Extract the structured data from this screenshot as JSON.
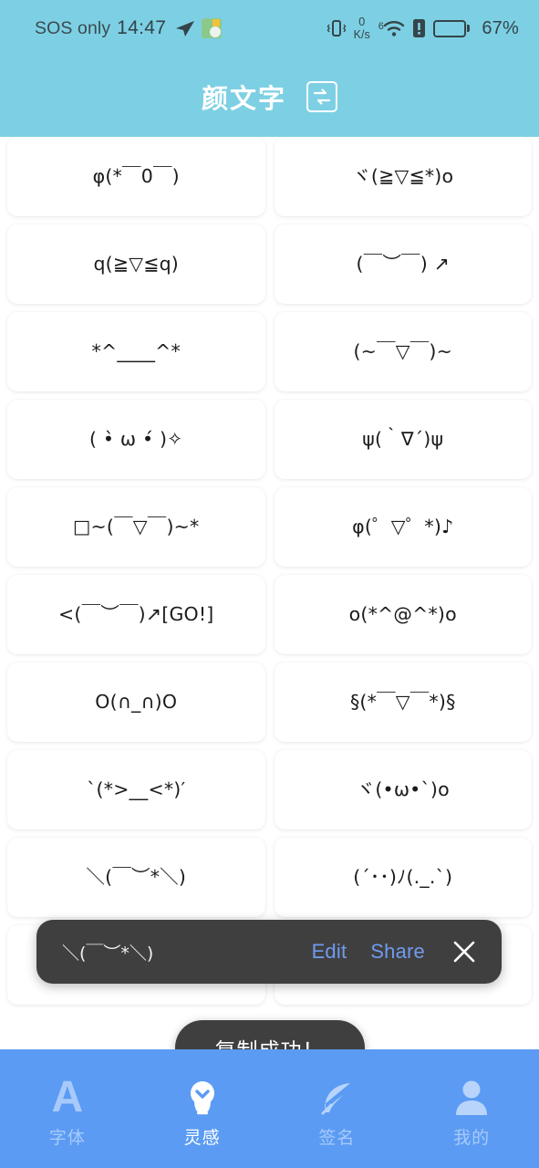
{
  "statusbar": {
    "carrier": "SOS only",
    "time": "14:47",
    "telegram_icon": "telegram-icon",
    "app_icon": "app-icon",
    "vibrate_icon": "vibrate-icon",
    "net_speed_value": "0",
    "net_speed_unit": "K/s",
    "wifi_icon": "wifi-icon",
    "wifi_generation": "6",
    "sim_alert_icon": "sim-alert-icon",
    "battery_icon": "battery-icon",
    "battery_percent": "67%",
    "battery_level": 67
  },
  "header": {
    "title": "颜文字",
    "swap_icon": "swap-refresh-icon",
    "bg_color": "#7dd0e3"
  },
  "grid": {
    "items": [
      "φ(*￣0￣)",
      "ヾ(≧▽≦*)o",
      "q(≧▽≦q)",
      "(￣︶￣) ↗",
      "*^____^*",
      "(~￣▽￣)~",
      "( •̀ ω •́ )✧",
      "ψ(｀∇´)ψ",
      "□~(￣▽￣)~*",
      "φ(゜▽゜*)♪",
      "<(￣︶￣)↗[GO!]",
      "o(*^@^*)o",
      "O(∩_∩)O",
      "§(*￣▽￣*)§",
      "`(*>__<*)′",
      "ヾ(•ω•`)o",
      "＼(￣︶*＼)",
      "(´･･)ﾉ(._.`)",
      "",
      ""
    ]
  },
  "action_bar": {
    "kaomoji": "＼(￣︶*＼)",
    "edit_label": "Edit",
    "share_label": "Share",
    "close_icon": "close-icon",
    "bg_color": "#403f3f",
    "link_color": "#6f9bf0"
  },
  "toast": {
    "message": "复制成功！"
  },
  "bottomnav": {
    "bg_color": "#5b9bf3",
    "items": [
      {
        "label": "字体",
        "icon": "letter-a-icon",
        "active": false
      },
      {
        "label": "灵感",
        "icon": "lightbulb-icon",
        "active": true
      },
      {
        "label": "签名",
        "icon": "feather-pen-icon",
        "active": false
      },
      {
        "label": "我的",
        "icon": "person-icon",
        "active": false
      }
    ]
  }
}
